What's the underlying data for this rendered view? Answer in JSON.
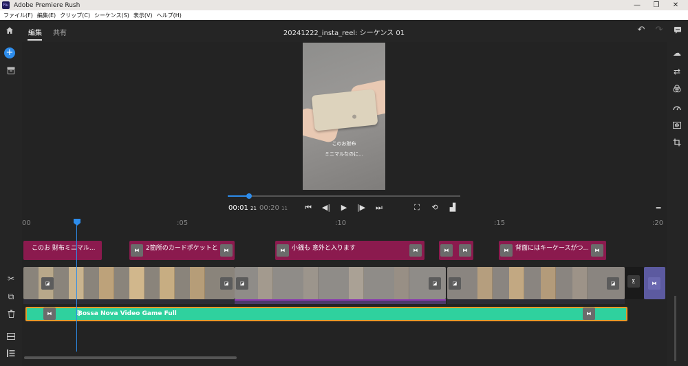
{
  "window": {
    "title": "Adobe Premiere Rush",
    "app_icon_text": "Ru",
    "controls": {
      "minimize": "—",
      "restore": "❐",
      "close": "✕"
    }
  },
  "menu": [
    "ファイル(F)",
    "編集(E)",
    "クリップ(C)",
    "シーケンス(S)",
    "表示(V)",
    "ヘルプ(H)"
  ],
  "top_tabs": {
    "edit": "編集",
    "share": "共有"
  },
  "sequence_title": "20241222_insta_reel: シーケンス 01",
  "preview": {
    "caption_line1": "このお財布",
    "caption_line2": "ミニマルなのに…"
  },
  "playback": {
    "current_time": "00:01",
    "current_frames": "21",
    "duration": "00:20",
    "duration_frames": "11",
    "progress": 0.09
  },
  "ruler": {
    "ticks": [
      "00",
      ":05",
      ":10",
      ":15",
      ":20"
    ]
  },
  "title_clips": [
    {
      "label": "このお 財布ミニマル..."
    },
    {
      "label": "2箇所のカードポケットと..."
    },
    {
      "label": "小銭も 意外と入ります"
    },
    {
      "label": ""
    },
    {
      "label": "背面にはキーケースがつ..."
    }
  ],
  "music_clip": {
    "label": "Bossa Nova Video Game Full",
    "note_icon": "♫"
  },
  "handle_glyph": "⧓",
  "colors": {
    "accent": "#2d8ceb",
    "title_clip": "#8b1a4e",
    "music_clip": "#2fd19e",
    "music_border": "#e59a2a"
  }
}
